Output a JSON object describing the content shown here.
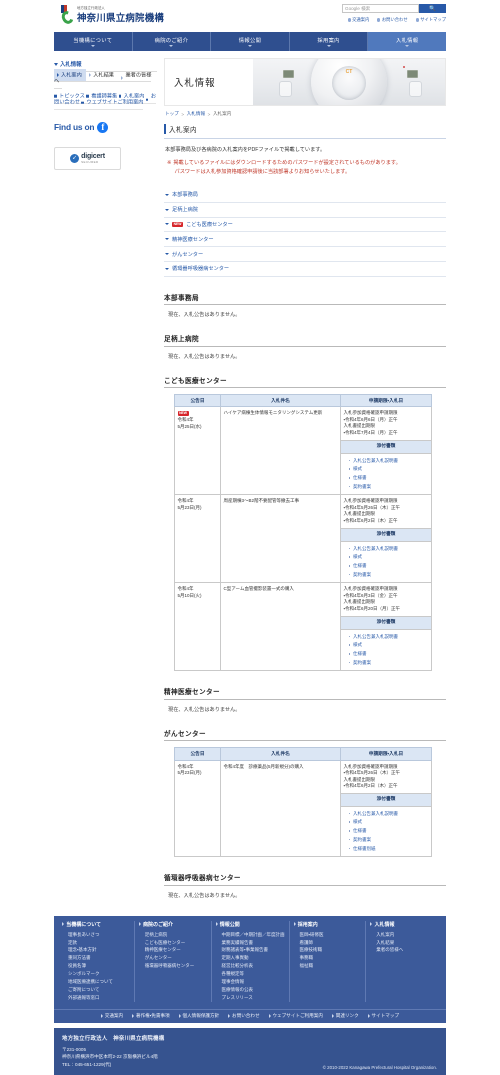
{
  "header": {
    "logo_small": "地方独立行政法人",
    "logo_main": "神奈川県立病院機構",
    "search_placeholder": "Google 検索",
    "search_value": "",
    "search_button_icon": "search-icon",
    "util_links": [
      "交通案内",
      "お問い合わせ",
      "サイトマップ"
    ]
  },
  "global_nav": [
    {
      "label": "当機構について",
      "active": false
    },
    {
      "label": "病院のご紹介",
      "active": false
    },
    {
      "label": "情報公開",
      "active": false
    },
    {
      "label": "採用案内",
      "active": false
    },
    {
      "label": "入札情報",
      "active": true
    }
  ],
  "sidebar": {
    "heading": "入札情報",
    "items": [
      {
        "label": "入札案内",
        "active": true
      },
      {
        "label": "入札結果",
        "active": false
      },
      {
        "label": "業者の皆様へ",
        "active": false
      }
    ],
    "links": [
      "トピックス",
      "看護師募集",
      "入札案内",
      "お問い合わせ",
      "ウェブサイトご利用案内"
    ],
    "find_us_text": "Find us on",
    "facebook_icon": "facebook-icon",
    "digicert": {
      "name": "digicert",
      "sub": "SECURED"
    }
  },
  "banner": {
    "title": "入札情報",
    "image": "ct-scanner-photo",
    "ct_logo": "CT"
  },
  "breadcrumb": [
    {
      "label": "トップ",
      "link": true
    },
    {
      "label": "入札情報",
      "link": true
    },
    {
      "label": "入札案内",
      "link": false
    }
  ],
  "main": {
    "page_heading": "入札案内",
    "lead": "本部事務局及び各病院の入札案内をPDFファイルで掲載しています。",
    "note_mark": "※",
    "note_line1": "掲載しているファイルにはダウンロードするためのパスワードが設定されているものがあります。",
    "note_line2": "パスワードは入札参加資格確認申請後に当該部署よりお知らせいたします。",
    "anchors": [
      {
        "label": "本部事務局",
        "new": false
      },
      {
        "label": "足柄上病院",
        "new": false
      },
      {
        "label": "こども医療センター",
        "new": true
      },
      {
        "label": "精神医療センター",
        "new": false
      },
      {
        "label": "がんセンター",
        "new": false
      },
      {
        "label": "循環器呼吸器病センター",
        "new": false
      }
    ],
    "new_badge_label": "NEW",
    "empty_text": "現在、入札公告はありません。",
    "table_headers": [
      "公告日",
      "入札件名",
      "申請期限・入札日"
    ],
    "attach_header": "添付書類",
    "sections": [
      {
        "title": "本部事務局",
        "empty": true,
        "rows": []
      },
      {
        "title": "足柄上病院",
        "empty": true,
        "rows": []
      },
      {
        "title": "こども医療センター",
        "empty": false,
        "rows": [
          {
            "new": true,
            "date_line1": "令和4年",
            "date_line2": "5月25日(水)",
            "name": "ハイケア病棟生体情報モニタリングシステム更新",
            "terms": [
              "入札参加資格確認申請期限",
              "・令和4年6月6日（月）正午",
              "入札書提出期限",
              "・令和4年7月4日（月）正午"
            ],
            "attachments": [
              "入札公告兼入札説明書",
              "様式",
              "仕様書",
              "契約書案"
            ]
          },
          {
            "new": false,
            "date_line1": "令和4年",
            "date_line2": "5月23日(月)",
            "name": "周産期棟3～B2階不要配管等撤去工事",
            "terms": [
              "入札参加資格確認申請期限",
              "・令和4年5月26日（木）正午",
              "入札書提出期限",
              "・令和4年6月2日（木）正午"
            ],
            "attachments": [
              "入札公告兼入札説明書",
              "様式",
              "仕様書",
              "契約書案"
            ]
          },
          {
            "new": false,
            "date_line1": "令和4年",
            "date_line2": "5月10日(火)",
            "name": "C型アーム血管撮影装置一式の購入",
            "terms": [
              "入札参加資格確認申請期限",
              "・令和4年6月3日（金）正午",
              "入札書提出期限",
              "・令和4年6月20日（月）正午"
            ],
            "attachments": [
              "入札公告兼入札説明書",
              "様式",
              "仕様書",
              "契約書案"
            ]
          }
        ]
      },
      {
        "title": "精神医療センター",
        "empty": true,
        "rows": []
      },
      {
        "title": "がんセンター",
        "empty": false,
        "rows": [
          {
            "new": false,
            "date_line1": "令和4年",
            "date_line2": "5月23日(月)",
            "name": "令和4年度　診療薬品(5月新規分)の購入",
            "terms": [
              "入札参加資格確認申請期限",
              "・令和4年5月26日（木）正午",
              "入札書提出期限",
              "・令和4年6月2日（木）正午"
            ],
            "attachments": [
              "入札公告兼入札説明書",
              "様式",
              "仕様書",
              "契約書案",
              "仕様書別紙"
            ]
          }
        ]
      },
      {
        "title": "循環器呼吸器病センター",
        "empty": true,
        "rows": []
      }
    ]
  },
  "footer": {
    "columns": [
      {
        "head": "当機構について",
        "items": [
          "理事長あいさつ",
          "定款",
          "理念・基本方針",
          "重同方法書",
          "役員名簿",
          "シンボルマーク",
          "地域医療連携について",
          "ご寄附について",
          "外部通報等窓口"
        ]
      },
      {
        "head": "病院のご紹介",
        "items": [
          "足柄上病院",
          "こども医療センター",
          "精神医療センター",
          "がんセンター",
          "循環器呼吸器病センター"
        ]
      },
      {
        "head": "情報公開",
        "items": [
          "中期目標／中期計画／年度計画",
          "業務実績報告書",
          "財務諸表等・事業報告書",
          "定期人事異動",
          "経営比較分析表",
          "各種規定等",
          "理事会情報",
          "医療情報の公表",
          "プレスリリース"
        ]
      },
      {
        "head": "採用案内",
        "items": [
          "医師・研修医",
          "看護師",
          "医療技術職",
          "事務職",
          "福祉職"
        ]
      },
      {
        "head": "入札情報",
        "items": [
          "入札案内",
          "入札結果",
          "業者の皆様へ"
        ]
      }
    ],
    "bar_links": [
      "交通案内",
      "著作権・免責事項",
      "個人情報保護方針",
      "お問い合わせ",
      "ウェブサイトご利用案内",
      "関連リンク",
      "サイトマップ"
    ],
    "org": "地方独立行政法人　神奈川県立病院機構",
    "address_lines": [
      "〒231-0005",
      "神奈川県横浜市中区本町2-22 京阪横浜ビル4階",
      "TEL：045-651-1229(代)"
    ],
    "copyright": "© 2010-2022 Kanagawa Prefectural Hospital Organization."
  }
}
